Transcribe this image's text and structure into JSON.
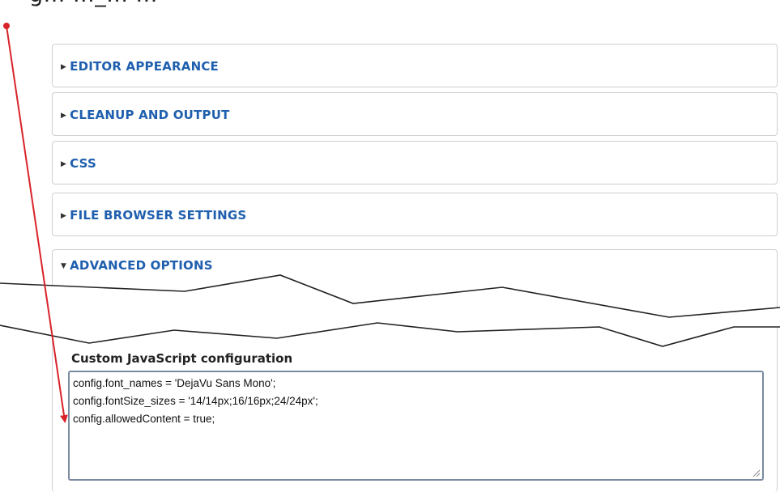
{
  "top_text": "g... ..._... ...",
  "sections": [
    {
      "label": "EDITOR APPEARANCE"
    },
    {
      "label": "CLEANUP AND OUTPUT"
    },
    {
      "label": "CSS"
    },
    {
      "label": "FILE BROWSER SETTINGS"
    }
  ],
  "advanced": {
    "label": "ADVANCED OPTIONS",
    "config_label": "Custom JavaScript configuration",
    "config_lines": [
      "config.font_names = 'DejaVu Sans Mono';",
      "config.fontSize_sizes = '14/14px;16/16px;24/24px';",
      "config.allowedContent = true;"
    ]
  },
  "colors": {
    "link_blue": "#1f5fae",
    "annotation_red": "#d9232a"
  },
  "icons": {
    "collapsed": "caret-right-icon",
    "expanded": "caret-down-icon"
  }
}
